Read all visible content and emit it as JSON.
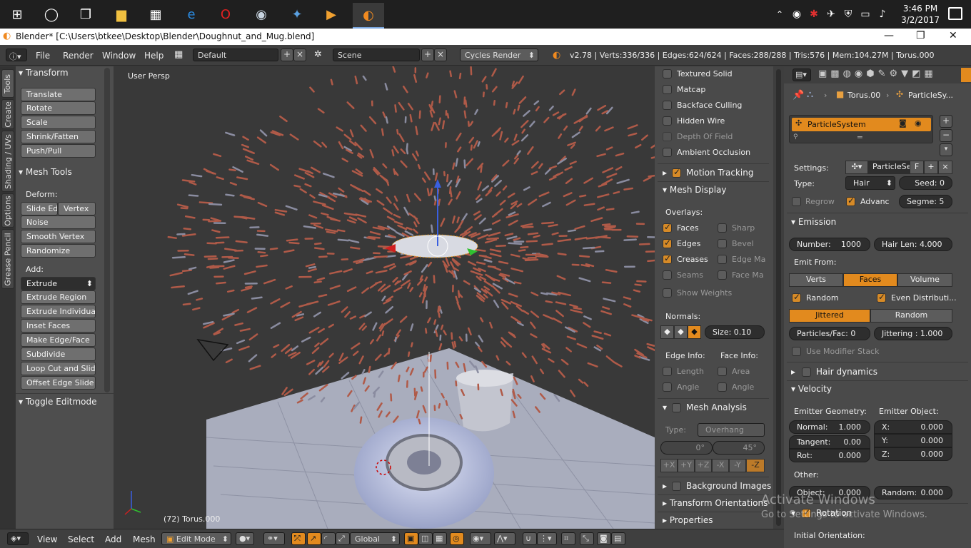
{
  "taskbar": {
    "time": "3:46 PM",
    "date": "3/2/2017"
  },
  "window": {
    "title": "Blender* [C:\\Users\\btkee\\Desktop\\Blender\\Doughnut_and_Mug.blend]"
  },
  "menubar": {
    "items": [
      "File",
      "Render",
      "Window",
      "Help"
    ],
    "layout": "Default",
    "scene": "Scene",
    "engine": "Cycles Render",
    "stats": "v2.78 | Verts:336/336 | Edges:624/624 | Faces:288/288 | Tris:576 | Mem:104.27M | Torus.000"
  },
  "left_tabs": [
    "Tools",
    "Create",
    "Shading / UVs",
    "Options",
    "Grease Pencil"
  ],
  "toolshelf": {
    "transform_header": "Transform",
    "transform_buttons": [
      "Translate",
      "Rotate",
      "Scale",
      "Shrink/Fatten",
      "Push/Pull"
    ],
    "meshtools_header": "Mesh Tools",
    "deform_label": "Deform:",
    "slide_edge": "Slide Ed",
    "vertex": "Vertex",
    "deform_buttons": [
      "Noise",
      "Smooth Vertex",
      "Randomize"
    ],
    "add_label": "Add:",
    "extrude": "Extrude",
    "add_buttons": [
      "Extrude Region",
      "Extrude Individual",
      "Inset Faces",
      "Make Edge/Face",
      "Subdivide",
      "Loop Cut and Slide",
      "Offset Edge Slide"
    ],
    "toggle_editmode": "Toggle Editmode"
  },
  "viewport": {
    "view_label": "User Persp",
    "object_label": "(72) Torus.000"
  },
  "props3d": {
    "shading": [
      {
        "label": "Textured Solid",
        "checked": false
      },
      {
        "label": "Matcap",
        "checked": false
      },
      {
        "label": "Backface Culling",
        "checked": false
      },
      {
        "label": "Hidden Wire",
        "checked": false
      },
      {
        "label": "Depth Of Field",
        "checked": false,
        "dim": true
      },
      {
        "label": "Ambient Occlusion",
        "checked": false
      }
    ],
    "motion_tracking": "Motion Tracking",
    "mesh_display": "Mesh Display",
    "overlays_label": "Overlays:",
    "overlays_left": [
      {
        "label": "Faces",
        "checked": true
      },
      {
        "label": "Edges",
        "checked": true
      },
      {
        "label": "Creases",
        "checked": true
      },
      {
        "label": "Seams",
        "checked": false
      }
    ],
    "overlays_right": [
      {
        "label": "Sharp",
        "checked": false
      },
      {
        "label": "Bevel",
        "checked": false
      },
      {
        "label": "Edge Ma",
        "checked": false
      },
      {
        "label": "Face Ma",
        "checked": false
      }
    ],
    "show_weights": "Show Weights",
    "normals_label": "Normals:",
    "size_field": "Size:  0.10",
    "edge_info": "Edge Info:",
    "face_info": "Face Info:",
    "length": "Length",
    "area": "Area",
    "angle_edge": "Angle",
    "angle_face": "Angle",
    "mesh_analysis": "Mesh Analysis",
    "type_label": "Type:",
    "type_value": "Overhang",
    "angle_min": "0°",
    "angle_max": "45°",
    "axes": [
      "+X",
      "+Y",
      "+Z",
      "-X",
      "-Y",
      "-Z"
    ],
    "background_images": "Background Images",
    "transform_orientations": "Transform Orientations",
    "properties": "Properties"
  },
  "props": {
    "breadcrumb_object": "Torus.00",
    "breadcrumb_ps": "ParticleSy...",
    "ps_list_item": "ParticleSystem",
    "settings_label": "Settings:",
    "settings_value": "ParticleSe",
    "settings_f": "F",
    "type_label": "Type:",
    "type_value": "Hair",
    "seed": "Seed:  0",
    "regrow": "Regrow",
    "advanced": "Advanc",
    "segments": "Segme: 5",
    "emission": "Emission",
    "number": "Number:",
    "number_value": "1000",
    "hair_len": "Hair Len: 4.000",
    "emit_from": "Emit From:",
    "emit_tabs": [
      "Verts",
      "Faces",
      "Volume"
    ],
    "random": "Random",
    "even_dist": "Even Distributi...",
    "dist_tabs": [
      "Jittered",
      "Random"
    ],
    "particles_fac": "Particles/Fac:  0",
    "jittering": "Jittering :  1.000",
    "use_modifier": "Use Modifier Stack",
    "hair_dynamics": "Hair dynamics",
    "velocity": "Velocity",
    "emitter_geometry": "Emitter Geometry:",
    "emitter_object": "Emitter Object:",
    "normal": "Normal:",
    "normal_value": "1.000",
    "tangent": "Tangent:",
    "tangent_value": "0.00",
    "rot": "Rot:",
    "rot_value": "0.000",
    "x": "X:",
    "x_value": "0.000",
    "y": "Y:",
    "y_value": "0.000",
    "z": "Z:",
    "z_value": "0.000",
    "other": "Other:",
    "object": "Object:",
    "object_value": "0.000",
    "random_v": "Random:",
    "random_v_value": "0.000",
    "rotation": "Rotation",
    "initial_orientation": "Initial Orientation:"
  },
  "bottombar": {
    "menus": [
      "View",
      "Select",
      "Add",
      "Mesh"
    ],
    "mode": "Edit Mode",
    "orientation": "Global"
  },
  "watermark": {
    "line1": "Activate Windows",
    "line2": "Go to Settings to activate Windows."
  }
}
